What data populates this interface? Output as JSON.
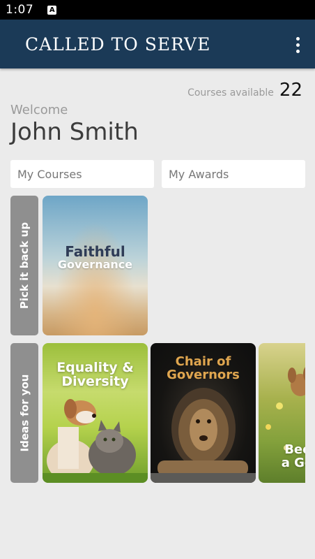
{
  "status_bar": {
    "time": "1:07",
    "notification_icon": "A"
  },
  "app_bar": {
    "title": "CALLED TO SERVE",
    "menu_icon": "more-vert-icon"
  },
  "summary": {
    "courses_available_label": "Courses available",
    "courses_available_count": "22"
  },
  "user": {
    "welcome": "Welcome",
    "name": "John Smith"
  },
  "tabs": {
    "my_courses": "My Courses",
    "my_awards": "My Awards"
  },
  "rows": {
    "pick_up": {
      "label": "Pick it back up",
      "cards": [
        {
          "title_line1": "Faithful",
          "title_line2": "Governance"
        }
      ]
    },
    "ideas": {
      "label": "Ideas for you",
      "cards": [
        {
          "title_line1": "Equality &",
          "title_line2": "Diversity"
        },
        {
          "title_line1": "Chair of",
          "title_line2": "Governors"
        },
        {
          "title_line1": "Bec",
          "title_line2": "a Go"
        }
      ]
    }
  }
}
